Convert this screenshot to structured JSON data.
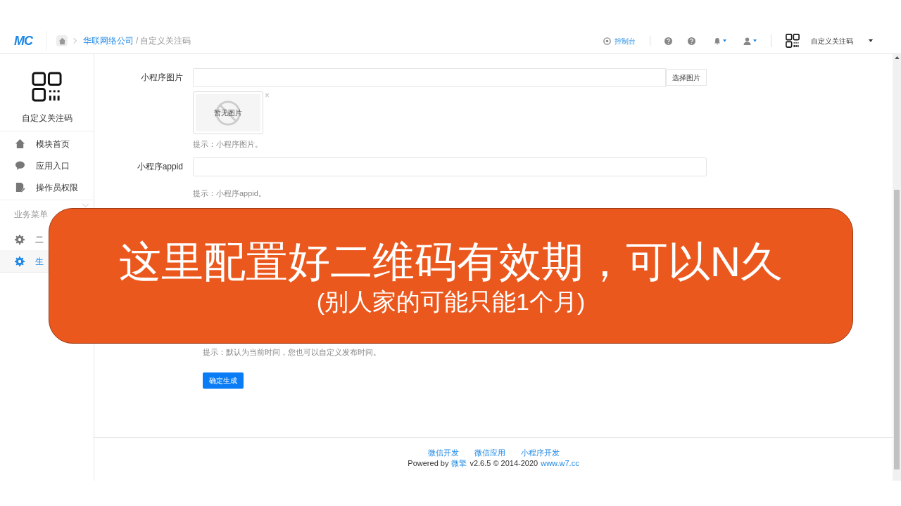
{
  "header": {
    "logo": "MC",
    "company_link": "华联网络公司",
    "separator": "/",
    "current_page": "自定义关注码",
    "console": "控制台",
    "module_name": "自定义关注码"
  },
  "sidebar": {
    "module_title": "自定义关注码",
    "items": [
      {
        "label": "模块首页",
        "selected": false
      },
      {
        "label": "应用入口",
        "selected": false
      },
      {
        "label": "操作员权限",
        "selected": false
      }
    ],
    "section": {
      "title": "业务菜单",
      "items": [
        {
          "label": "二",
          "selected": false
        },
        {
          "label": "生",
          "selected": true
        }
      ]
    }
  },
  "form": {
    "fields": [
      {
        "kind": "image",
        "label": "小程序图片",
        "button": "选择图片",
        "preview": "暂无图片",
        "remove": "×",
        "hint": "提示：小程序图片。"
      },
      {
        "kind": "text",
        "label": "小程序appid",
        "hint": "提示：小程序appid。"
      }
    ],
    "time_hint": "提示：默认为当前时间，您也可以自定义发布时间。",
    "submit": "确定生成"
  },
  "footer": {
    "links": [
      "微信开发",
      "微信应用",
      "小程序开发"
    ],
    "powered_by": "Powered by",
    "brand_link": "微擎",
    "version": "v2.6.5 © 2014-2020",
    "site_link": "www.w7.cc"
  },
  "banner": {
    "title": "这里配置好二维码有效期，可以N久",
    "subtitle": "(别人家的可能只能1个月)"
  }
}
